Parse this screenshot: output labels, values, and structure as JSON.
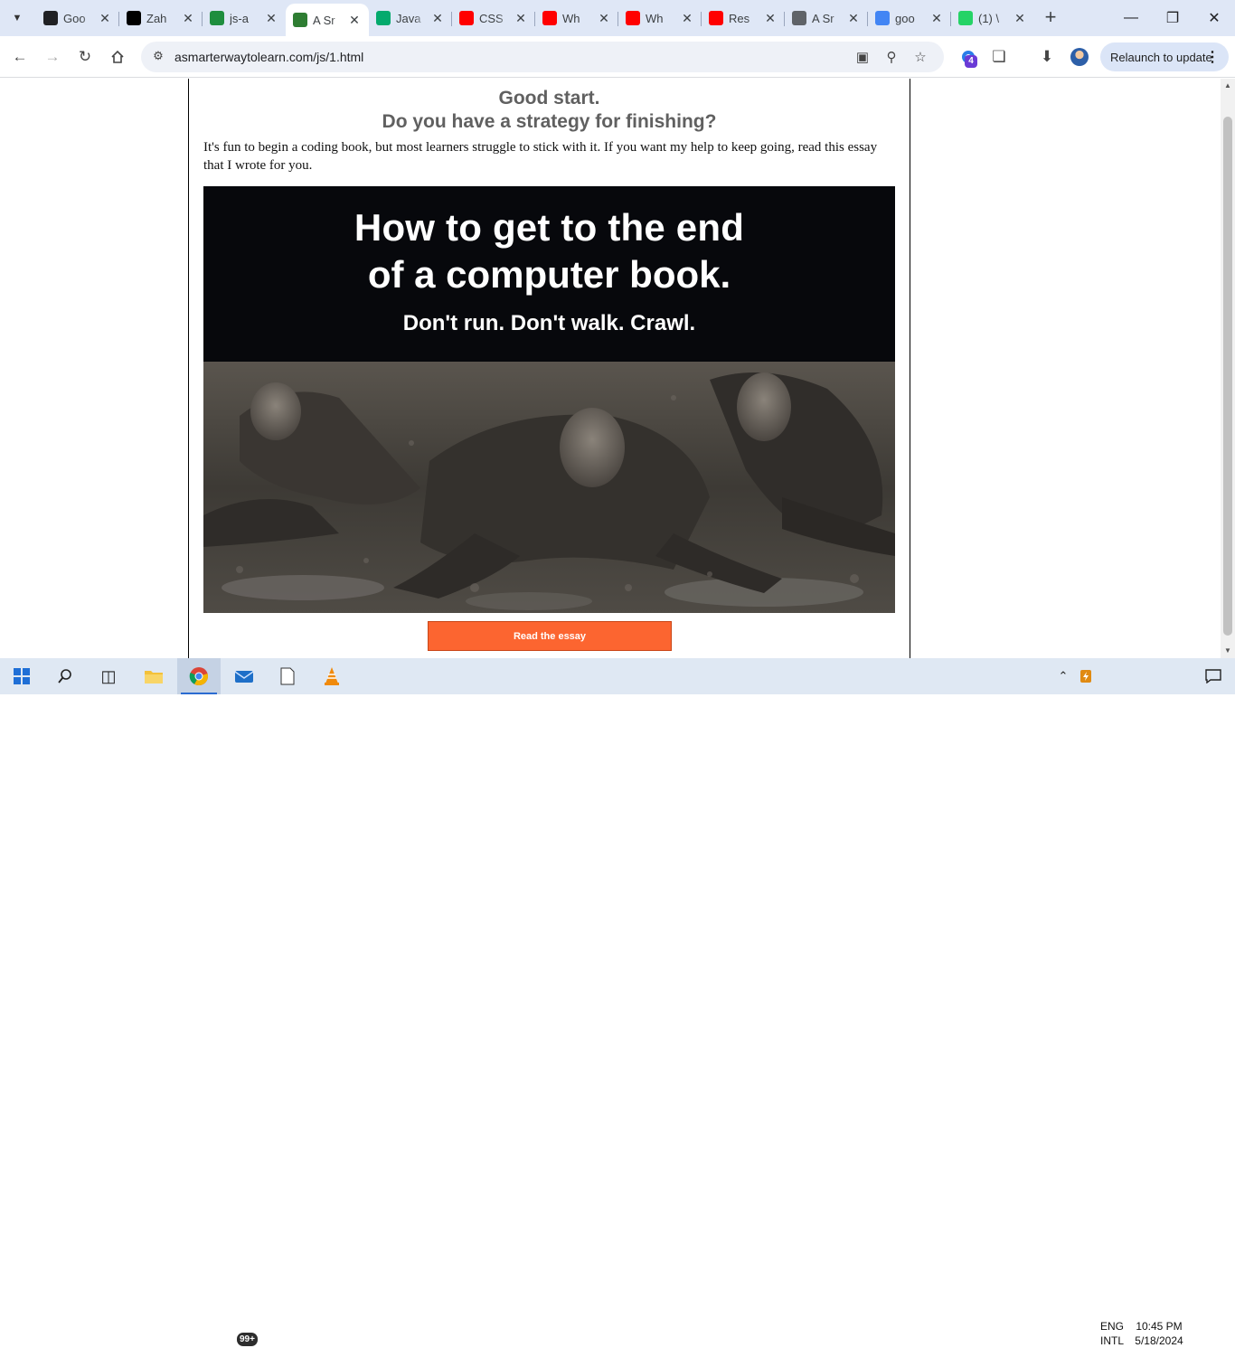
{
  "browser": {
    "tabs": [
      {
        "title": "Goo",
        "icon": "openai-icon",
        "color": "#202124"
      },
      {
        "title": "Zah",
        "icon": "github-icon",
        "color": "#000000"
      },
      {
        "title": "js-a",
        "icon": "google-classroom-icon",
        "color": "#1e8e3e"
      },
      {
        "title": "A Sr",
        "icon": "smarter-way-icon",
        "color": "#2e7d32",
        "active": true
      },
      {
        "title": "Java",
        "icon": "w3schools-icon",
        "color": "#04aa6d"
      },
      {
        "title": "CSS",
        "icon": "youtube-icon",
        "color": "#ff0000"
      },
      {
        "title": "Wh",
        "icon": "youtube-icon",
        "color": "#ff0000"
      },
      {
        "title": "Wh",
        "icon": "youtube-icon",
        "color": "#ff0000"
      },
      {
        "title": "Res",
        "icon": "youtube-icon",
        "color": "#ff0000"
      },
      {
        "title": "A Sr",
        "icon": "globe-icon",
        "color": "#5f6368"
      },
      {
        "title": "goo",
        "icon": "google-icon",
        "color": "#4285f4"
      },
      {
        "title": "(1) \\",
        "icon": "whatsapp-icon",
        "color": "#25d366"
      }
    ],
    "url": "asmarterwaytolearn.com/js/1.html",
    "extension_badge": "4",
    "relaunch_label": "Relaunch to update"
  },
  "page": {
    "heading_1": "Good start.",
    "heading_2": "Do you have a strategy for finishing?",
    "intro": "It's fun to begin a coding book, but most learners struggle to stick with it. If you want my help to keep going, read this essay that I wrote for you.",
    "hero": {
      "line_1": "How to get to the end",
      "line_2": "of a computer book.",
      "line_3": "Don't run. Don't walk. Crawl."
    },
    "cta_label": "Read the essay",
    "cta_color": "#fc6530"
  },
  "taskbar": {
    "mail_badge": "99+",
    "lang_top": "ENG",
    "lang_bottom": "INTL",
    "time": "10:45 PM",
    "date": "5/18/2024"
  }
}
